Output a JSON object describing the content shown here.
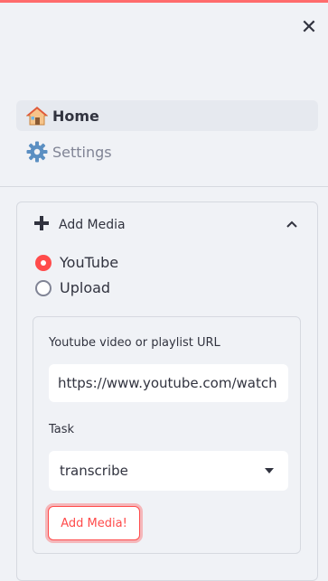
{
  "close_label": "✕",
  "nav": {
    "home": {
      "label": "Home",
      "icon": "house-icon"
    },
    "settings": {
      "label": "Settings",
      "icon": "gear-icon"
    }
  },
  "expander": {
    "title": "Add Media",
    "icon": "plus-icon",
    "chevron": "chevron-up-icon"
  },
  "source": {
    "options": [
      "YouTube",
      "Upload"
    ],
    "selected": "YouTube"
  },
  "form": {
    "url_label": "Youtube video or playlist URL",
    "url_value": "https://www.youtube.com/watch",
    "task_label": "Task",
    "task_value": "transcribe",
    "submit_label": "Add Media!"
  },
  "colors": {
    "accent": "#ff4b4b",
    "background": "#f0f2f6",
    "text": "#31333f"
  }
}
